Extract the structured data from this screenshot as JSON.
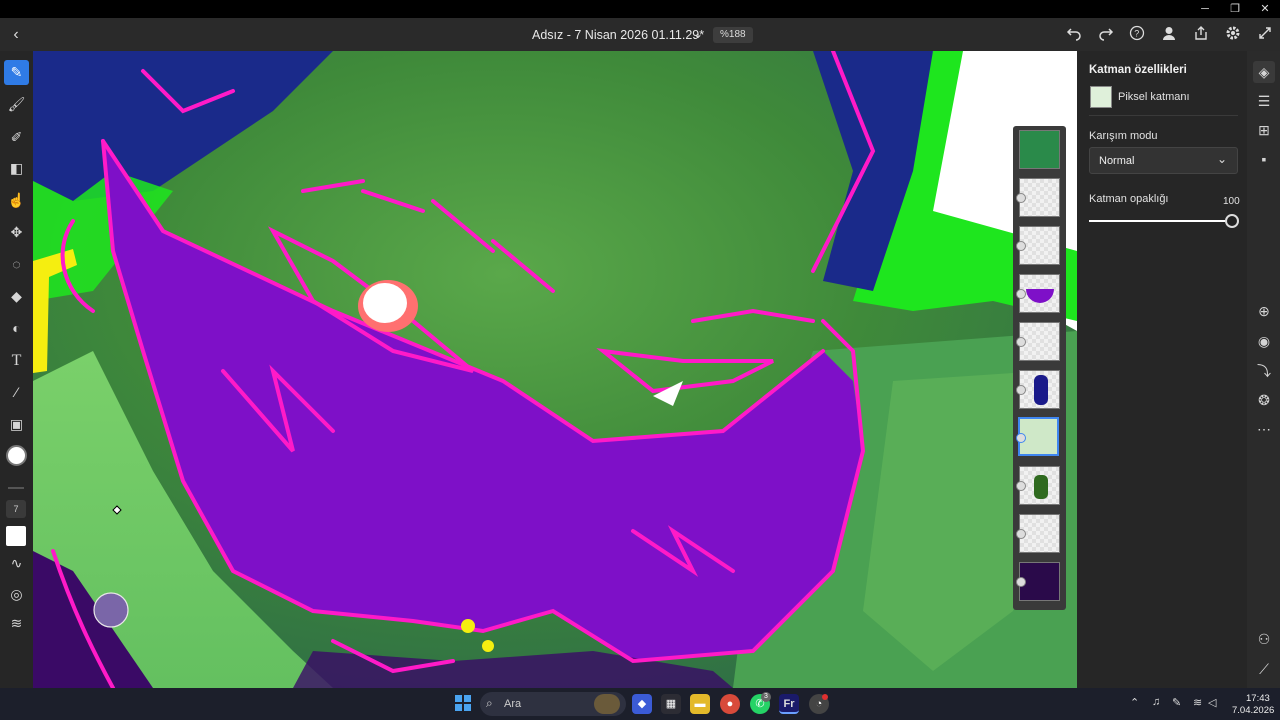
{
  "window": {
    "minimize": "─",
    "maximize": "❐",
    "close": "✕"
  },
  "topbar": {
    "back": "‹",
    "doc_title": "Adsız - 7 Nisan 2026 01.11.29*",
    "chevron": "⌄",
    "zoom": "%188",
    "icons": [
      "undo-icon",
      "redo-icon",
      "help-icon",
      "account-icon",
      "share-icon",
      "settings-icon",
      "fullscreen-icon"
    ]
  },
  "left_tools": {
    "icons": [
      "pixel-brush-icon",
      "paint-brush-icon",
      "mixer-brush-icon",
      "eraser-icon",
      "smudge-icon",
      "transform-icon",
      "lasso-icon",
      "fill-icon",
      "liquify-icon",
      "text-icon",
      "eyedropper-icon",
      "image-icon"
    ],
    "brush_size": "7"
  },
  "layers": {
    "count": 10,
    "selected_index": 6
  },
  "properties": {
    "title": "Katman özellikleri",
    "layer_type": "Piksel katmanı",
    "blend_label": "Karışım modu",
    "blend_value": "Normal",
    "opacity_label": "Katman opaklığı",
    "opacity_value": "100",
    "opacity_fraction": 1.0
  },
  "right_icons": [
    "layers-icon",
    "adjustments-icon",
    "grid-icon",
    "comment-icon",
    "add-layer-icon",
    "visibility-icon",
    "import-icon",
    "blend-icon",
    "more-icon",
    "group-icon",
    "ruler-icon"
  ],
  "taskbar": {
    "search_placeholder": "Ara",
    "whatsapp_badge": "3",
    "time": "17:43",
    "date": "7.04.2026"
  }
}
